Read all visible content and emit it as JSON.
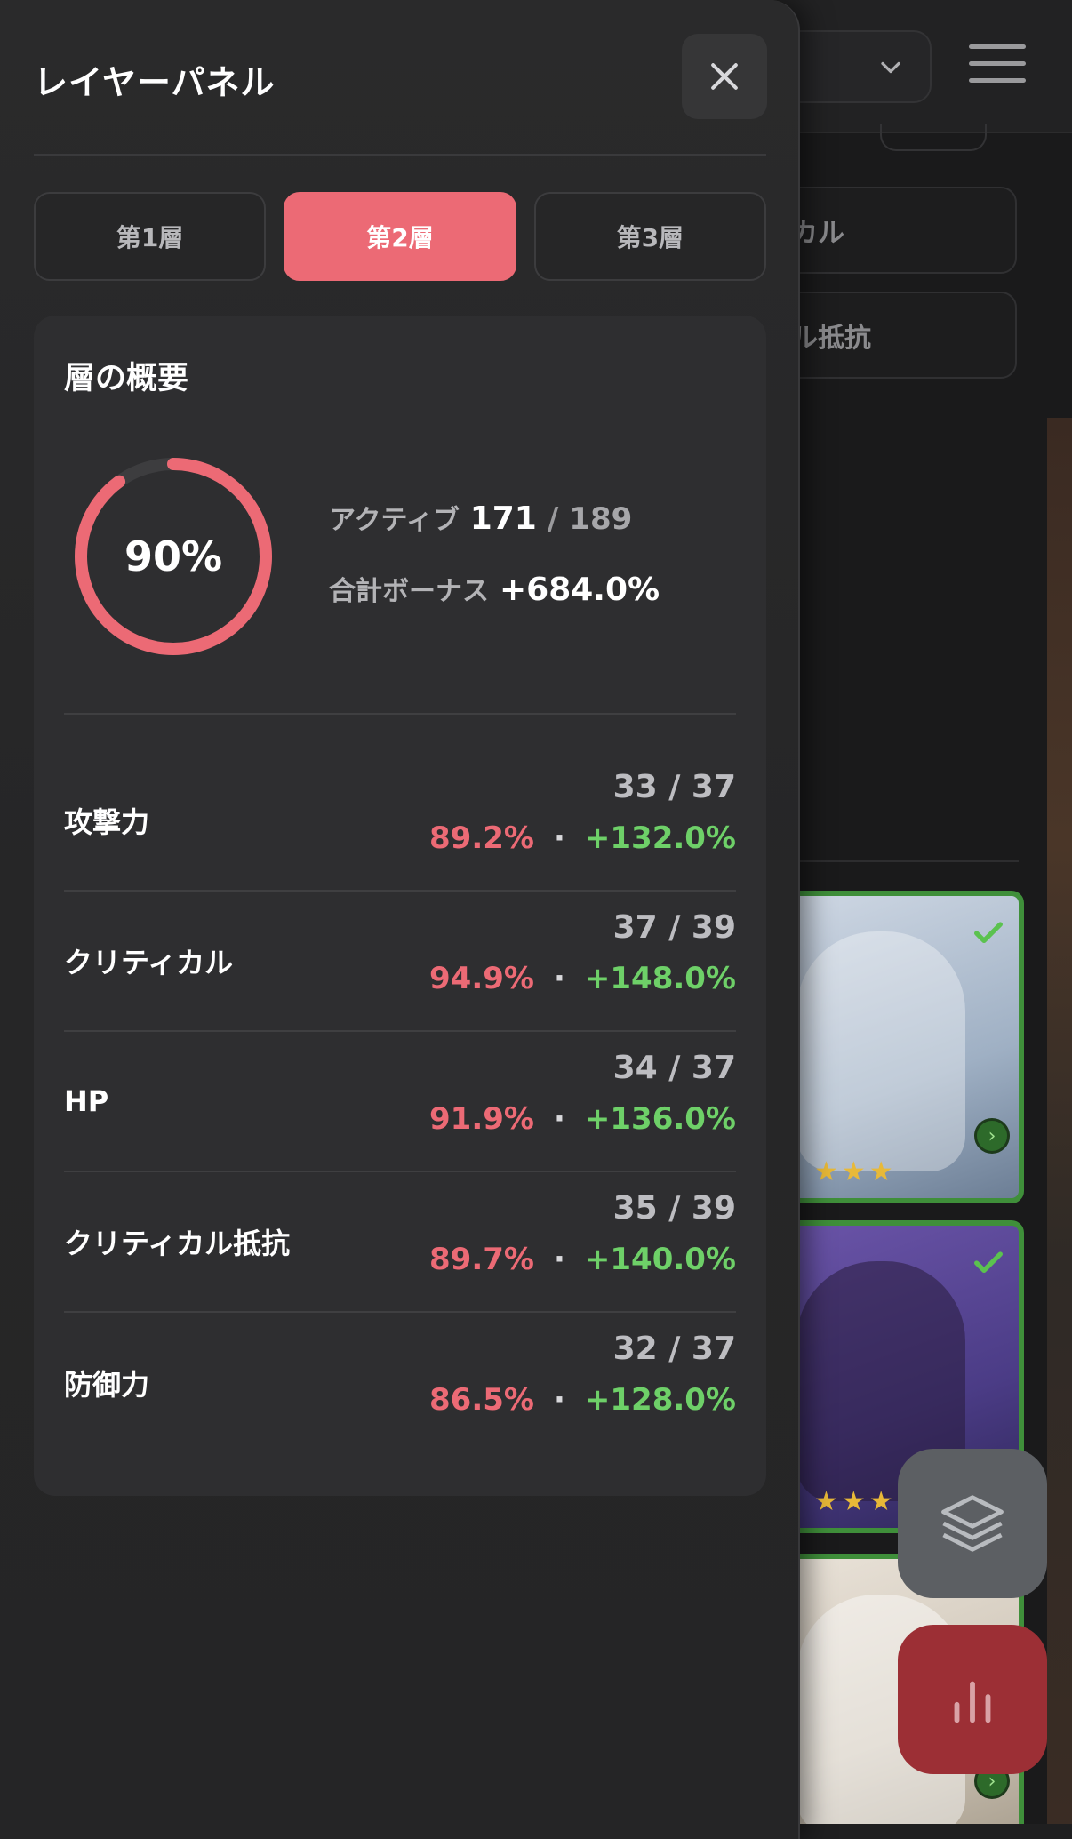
{
  "background": {
    "filters": [
      "カル",
      "ル抵抗"
    ],
    "cards": [
      {
        "stars": "★★★",
        "checked": true
      },
      {
        "stars": "★★★",
        "checked": true
      },
      {
        "stars": "",
        "checked": false
      }
    ]
  },
  "panel": {
    "title": "レイヤーパネル",
    "close_icon": "close-icon",
    "tabs": [
      {
        "label": "第1層",
        "active": false
      },
      {
        "label": "第2層",
        "active": true
      },
      {
        "label": "第3層",
        "active": false
      }
    ],
    "summary": {
      "title": "層の概要",
      "progress_percent": 90,
      "progress_label": "90%",
      "active_label": "アクティブ",
      "active_count": "171",
      "separator": "/",
      "active_total": "189",
      "bonus_label": "合計ボーナス",
      "bonus_value": "+684.0%"
    },
    "stats": [
      {
        "name": "攻撃力",
        "count": "33 / 37",
        "percent": "89.2%",
        "dot": "·",
        "bonus": "+132.0%"
      },
      {
        "name": "クリティカル",
        "count": "37 / 39",
        "percent": "94.9%",
        "dot": "·",
        "bonus": "+148.0%"
      },
      {
        "name": "HP",
        "count": "34 / 37",
        "percent": "91.9%",
        "dot": "·",
        "bonus": "+136.0%"
      },
      {
        "name": "クリティカル抵抗",
        "count": "35 / 39",
        "percent": "89.7%",
        "dot": "·",
        "bonus": "+140.0%"
      },
      {
        "name": "防御力",
        "count": "32 / 37",
        "percent": "86.5%",
        "dot": "·",
        "bonus": "+128.0%"
      }
    ]
  },
  "colors": {
    "accent": "#ec6a75",
    "bonus": "#6ed068",
    "panel_bg": "#2a2a2b"
  }
}
